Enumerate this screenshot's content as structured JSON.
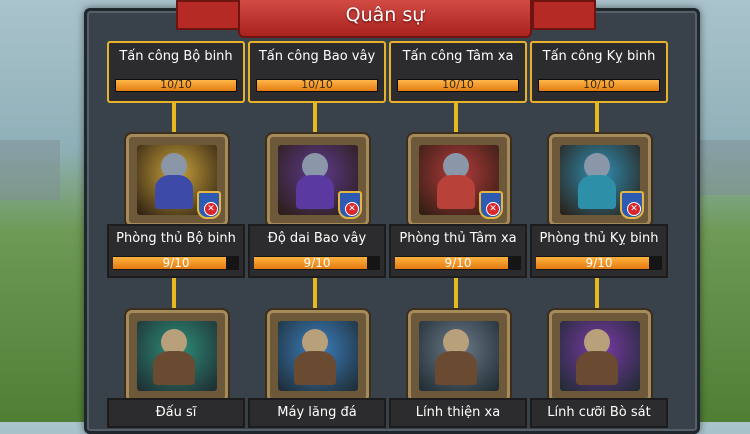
{
  "title": "Quân sự",
  "columns": [
    {
      "top_label": "Tấn công Bộ binh",
      "top_progress": "10/10",
      "top_fill": 1.0,
      "icon": "infantry-spearman-icon",
      "mid_label": "Phòng thủ Bộ binh",
      "mid_progress": "9/10",
      "mid_fill": 0.9,
      "bottom_icon": "gladiator-icon",
      "bottom_label": "Đấu sĩ",
      "color": "#3e4aa8"
    },
    {
      "top_label": "Tấn công Bao vây",
      "top_progress": "10/10",
      "top_fill": 1.0,
      "icon": "siege-sword-icon",
      "mid_label": "Độ dai Bao vây",
      "mid_progress": "9/10",
      "mid_fill": 0.9,
      "bottom_icon": "catapult-icon",
      "bottom_label": "Máy lăng đá",
      "color": "#5a3aa0"
    },
    {
      "top_label": "Tấn công Tâm xa",
      "top_progress": "10/10",
      "top_fill": 1.0,
      "icon": "crossbowman-icon",
      "mid_label": "Phòng thủ Tâm xa",
      "mid_progress": "9/10",
      "mid_fill": 0.9,
      "bottom_icon": "archer-icon",
      "bottom_label": "Lính thiện xa",
      "color": "#b8413a"
    },
    {
      "top_label": "Tấn công Kỵ binh",
      "top_progress": "10/10",
      "top_fill": 1.0,
      "icon": "cavalry-knight-icon",
      "mid_label": "Phòng thủ Kỵ binh",
      "mid_progress": "9/10",
      "mid_fill": 0.9,
      "bottom_icon": "reptile-rider-icon",
      "bottom_label": "Lính cưỡi Bò sát",
      "color": "#2d8fa8"
    }
  ],
  "colors": {
    "accent": "#e7b22a",
    "ribbon": "#b52a25",
    "panel": "#39424b",
    "progress": "#f09a22"
  }
}
